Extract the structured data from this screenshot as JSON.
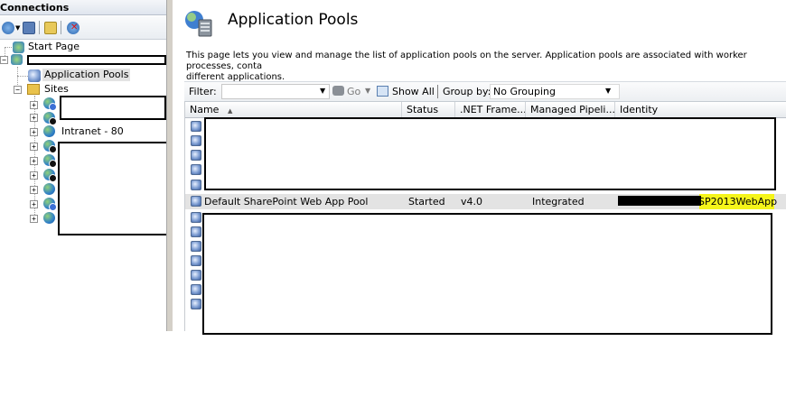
{
  "connections": {
    "title": "Connections",
    "tree": {
      "start_page": "Start Page",
      "app_pools": "Application Pools",
      "sites": "Sites",
      "intranet": "Intranet - 80"
    }
  },
  "header": {
    "title": "Application Pools",
    "description": "This page lets you view and manage the list of application pools on the server. Application pools are associated with worker processes, conta\ndifferent applications."
  },
  "filterbar": {
    "filter_label": "Filter:",
    "go_label": "Go",
    "show_all_label": "Show All",
    "group_by_label": "Group by:",
    "group_by_value": "No Grouping"
  },
  "table": {
    "columns": [
      "Name",
      "Status",
      ".NET Frame...",
      "Managed Pipeli...",
      "Identity"
    ],
    "sort_indicator": "▲",
    "selected_row": {
      "name": "Default SharePoint Web App Pool",
      "status": "Started",
      "net": "v4.0",
      "pipeline": "Integrated",
      "identity": "SP2013WebApp"
    }
  },
  "colors": {
    "selection": "#e3e3e3",
    "highlight": "#f5f51a"
  }
}
